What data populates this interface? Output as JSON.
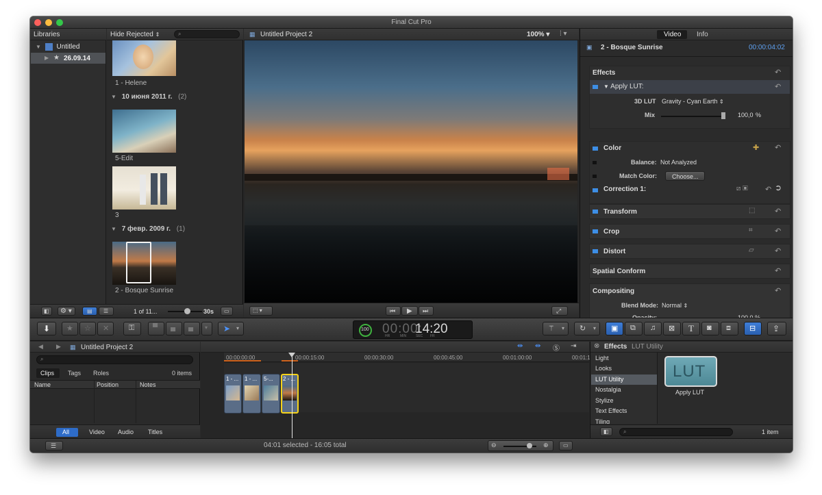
{
  "window": {
    "title": "Final Cut Pro"
  },
  "library": {
    "header": "Libraries",
    "filter": "Hide Rejected",
    "items": [
      {
        "label": "Untitled"
      },
      {
        "label": "26.09.14"
      }
    ],
    "groups": [
      {
        "date": "10 июня 2011 г.",
        "count": "(2)"
      },
      {
        "date": "7 февр. 2009 г.",
        "count": "(1)"
      }
    ],
    "clips": [
      "1 - Helene",
      "5-Edit",
      "3",
      "2 - Bosque Sunrise"
    ],
    "footer": {
      "count": "1 of 11...",
      "duration": "30s"
    }
  },
  "viewer": {
    "title": "Untitled Project 2",
    "zoom": "100%"
  },
  "inspector": {
    "tabs": [
      "Video",
      "Info"
    ],
    "clip_name": "2 - Bosque Sunrise",
    "timecode": "00:00:04:02",
    "effects_label": "Effects",
    "apply_lut": "Apply LUT:",
    "lut_label": "3D LUT",
    "lut_value": "Gravity - Cyan Earth",
    "mix_label": "Mix",
    "mix_value": "100,0",
    "mix_unit": "%",
    "color_label": "Color",
    "balance_label": "Balance:",
    "balance_value": "Not Analyzed",
    "match_label": "Match Color:",
    "match_button": "Choose...",
    "correction_label": "Correction 1:",
    "transform_label": "Transform",
    "crop_label": "Crop",
    "distort_label": "Distort",
    "spatial_label": "Spatial Conform",
    "compositing_label": "Compositing",
    "blend_label": "Blend Mode:",
    "blend_value": "Normal",
    "opacity_label": "Opacity:",
    "opacity_value": "100,0 %"
  },
  "toolbar": {
    "timecode": "14:20",
    "timecode_labels": [
      "HR",
      "MIN",
      "SEC",
      "FR"
    ],
    "meter": "100"
  },
  "timeline_index": {
    "title": "Untitled Project 2",
    "tabs": [
      "Clips",
      "Tags",
      "Roles"
    ],
    "count": "0 items",
    "columns": [
      "Name",
      "Position",
      "Notes"
    ],
    "bottom_tabs": [
      "All",
      "Video",
      "Audio",
      "Titles"
    ]
  },
  "timeline": {
    "ruler": [
      "00:00:00:00",
      "00:00:15:00",
      "00:00:30:00",
      "00:00:45:00",
      "00:01:00:00",
      "00:01:15:00"
    ],
    "clips": [
      "1 - ...",
      "1 - ...",
      "5-...",
      "2 - ..."
    ]
  },
  "effects_browser": {
    "title": "Effects",
    "subtitle": "LUT Utility",
    "categories": [
      "Light",
      "Looks",
      "LUT Utility",
      "Nostalgia",
      "Stylize",
      "Text Effects",
      "Tiling"
    ],
    "item_label": "Apply LUT",
    "item_icon_text": "LUT",
    "count": "1 item"
  },
  "statusbar": {
    "text": "04:01 selected - 16:05 total"
  }
}
